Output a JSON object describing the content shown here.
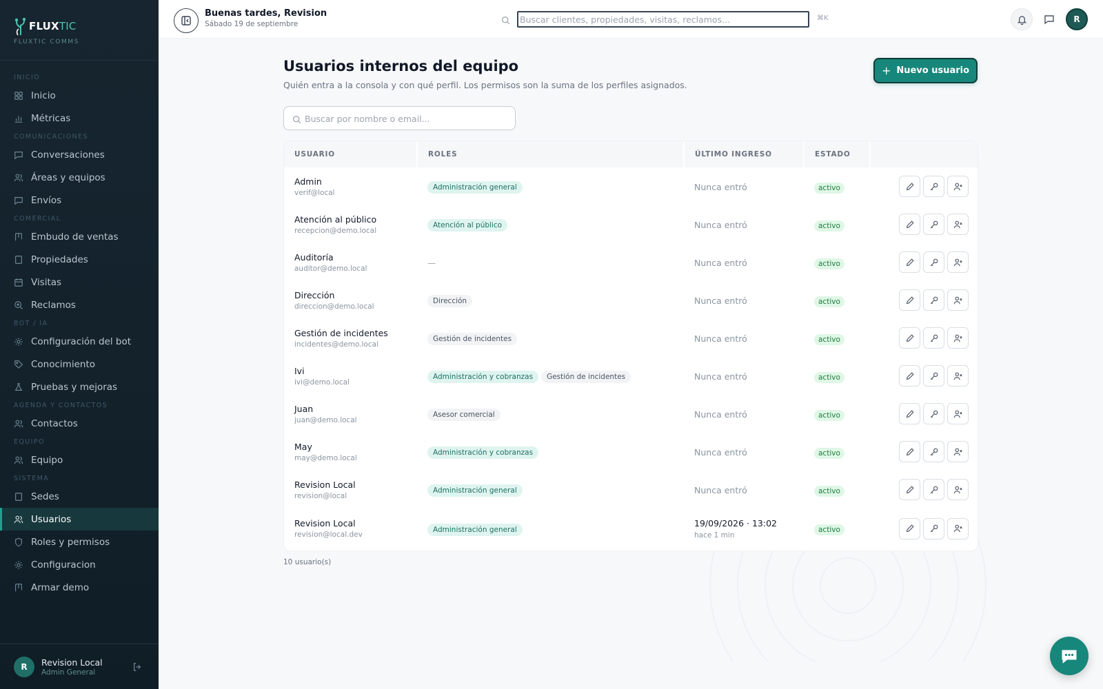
{
  "brand": {
    "name_a": "FLUX",
    "name_b": "TIC",
    "subtitle": "FLUXTIC COMMS"
  },
  "sidebar": {
    "groups": [
      {
        "label": "INICIO",
        "items": [
          {
            "label": "Inicio",
            "icon": "grid-icon"
          },
          {
            "label": "Métricas",
            "icon": "bar-chart-icon"
          }
        ]
      },
      {
        "label": "COMUNICACIONES",
        "items": [
          {
            "label": "Conversaciones",
            "icon": "message-icon"
          },
          {
            "label": "Áreas y equipos",
            "icon": "users-icon"
          },
          {
            "label": "Envíos",
            "icon": "message-icon"
          }
        ]
      },
      {
        "label": "COMERCIAL",
        "items": [
          {
            "label": "Embudo de ventas",
            "icon": "kanban-icon"
          },
          {
            "label": "Propiedades",
            "icon": "building-icon"
          },
          {
            "label": "Visitas",
            "icon": "calendar-icon"
          },
          {
            "label": "Reclamos",
            "icon": "search-alert-icon"
          }
        ]
      },
      {
        "label": "BOT / IA",
        "items": [
          {
            "label": "Configuración del bot",
            "icon": "gear-icon"
          },
          {
            "label": "Conocimiento",
            "icon": "tag-icon"
          },
          {
            "label": "Pruebas y mejoras",
            "icon": "flask-icon"
          }
        ]
      },
      {
        "label": "AGENDA Y CONTACTOS",
        "items": [
          {
            "label": "Contactos",
            "icon": "users-icon"
          }
        ]
      },
      {
        "label": "EQUIPO",
        "items": [
          {
            "label": "Equipo",
            "icon": "users-icon"
          }
        ]
      },
      {
        "label": "SISTEMA",
        "items": [
          {
            "label": "Sedes",
            "icon": "building-icon"
          },
          {
            "label": "Usuarios",
            "icon": "users-icon",
            "active": true
          },
          {
            "label": "Roles y permisos",
            "icon": "shield-icon"
          },
          {
            "label": "Configuracion",
            "icon": "gear-icon"
          },
          {
            "label": "Armar demo",
            "icon": "kanban-icon"
          }
        ]
      }
    ],
    "footer": {
      "avatar_initial": "R",
      "name": "Revision Local",
      "role": "Admin General"
    }
  },
  "topbar": {
    "greeting": "Buenas tardes, Revision",
    "date": "Sábado 19 de septiembre",
    "search_placeholder": "Buscar clientes, propiedades, visitas, reclamos...",
    "shortcut": "⌘K",
    "avatar_initial": "R"
  },
  "page": {
    "title": "Usuarios internos del equipo",
    "subtitle": "Quién entra a la consola y con qué perfil. Los permisos son la suma de los perfiles asignados.",
    "new_button": "Nuevo usuario",
    "search_placeholder": "Buscar por nombre o email...",
    "count": "10 usuario(s)"
  },
  "table": {
    "headers": [
      "USUARIO",
      "ROLES",
      "ÚLTIMO INGRESO",
      "ESTADO",
      ""
    ],
    "rows": [
      {
        "name": "Admin",
        "email": "verif@local",
        "roles": [
          {
            "label": "Administración general",
            "tone": "teal"
          }
        ],
        "last": "Nunca entró",
        "status": "activo"
      },
      {
        "name": "Atención al público",
        "email": "recepcion@demo.local",
        "roles": [
          {
            "label": "Atención al público",
            "tone": "teal"
          }
        ],
        "last": "Nunca entró",
        "status": "activo"
      },
      {
        "name": "Auditoría",
        "email": "auditor@demo.local",
        "roles": [],
        "roles_empty": "—",
        "last": "Nunca entró",
        "status": "activo"
      },
      {
        "name": "Dirección",
        "email": "direccion@demo.local",
        "roles": [
          {
            "label": "Dirección",
            "tone": "gray"
          }
        ],
        "last": "Nunca entró",
        "status": "activo"
      },
      {
        "name": "Gestión de incidentes",
        "email": "incidentes@demo.local",
        "roles": [
          {
            "label": "Gestión de incidentes",
            "tone": "gray"
          }
        ],
        "last": "Nunca entró",
        "status": "activo"
      },
      {
        "name": "Ivi",
        "email": "ivi@demo.local",
        "roles": [
          {
            "label": "Administración y cobranzas",
            "tone": "teal"
          },
          {
            "label": "Gestión de incidentes",
            "tone": "gray"
          }
        ],
        "last": "Nunca entró",
        "status": "activo"
      },
      {
        "name": "Juan",
        "email": "juan@demo.local",
        "roles": [
          {
            "label": "Asesor comercial",
            "tone": "gray"
          }
        ],
        "last": "Nunca entró",
        "status": "activo"
      },
      {
        "name": "May",
        "email": "may@demo.local",
        "roles": [
          {
            "label": "Administración y cobranzas",
            "tone": "teal"
          }
        ],
        "last": "Nunca entró",
        "status": "activo"
      },
      {
        "name": "Revision Local",
        "email": "revision@local",
        "roles": [
          {
            "label": "Administración general",
            "tone": "teal"
          }
        ],
        "last": "Nunca entró",
        "status": "activo"
      },
      {
        "name": "Revision Local",
        "email": "revision@local.dev",
        "roles": [
          {
            "label": "Administración general",
            "tone": "teal"
          }
        ],
        "last": "19/09/2026 · 13:02",
        "last_ago": "hace 1 min",
        "status": "activo"
      }
    ]
  },
  "colors": {
    "accent": "#17877b",
    "sidebar_bg": "#16252f",
    "active_bg": "#17383c"
  }
}
